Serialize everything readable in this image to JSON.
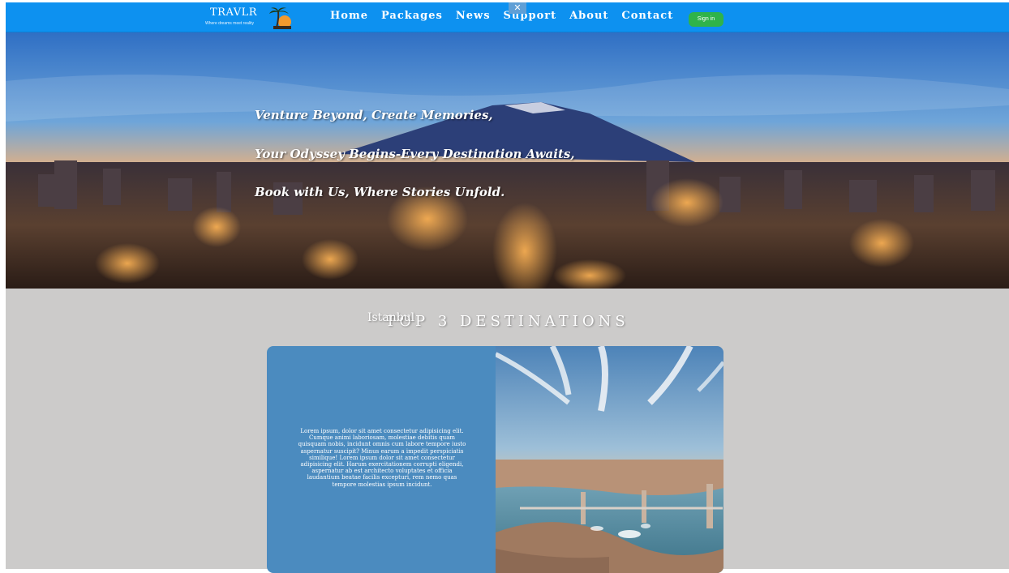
{
  "brand": {
    "name": "TRAVLR",
    "tagline": "Where dreams meet reality"
  },
  "nav": {
    "links": [
      "Home",
      "Packages",
      "News",
      "Support",
      "About",
      "Contact"
    ],
    "close_glyph": "✕",
    "signin_label": "Sign in"
  },
  "hero": {
    "lines": [
      "Venture Beyond, Create Memories,",
      "Your Odyssey Begins-Every Destination Awaits,",
      "Book with Us, Where Stories Unfold."
    ]
  },
  "destinations": {
    "title": "TOP 3 DESTINATIONS",
    "cards": [
      {
        "city": "Istanbul",
        "description": "Lorem ipsum, dolor sit amet consectetur adipisicing elit. Cumque animi laboriosam, molestiae debitis quam quisquam nobis, incidunt omnis cum labore tempore iusto aspernatur suscipit? Minus earum a impedit perspiciatis similique! Lorem ipsum dolor sit amet consectetur adipisicing elit. Harum exercitationem corrupti eligendi, aspernatur ab est architecto voluptates et officia laudantium beatae facilis excepturi, rem nemo quas tempore molestias ipsum incidunt."
      }
    ]
  },
  "colors": {
    "navbar": "#0d91f0",
    "signin": "#2fb34a",
    "section_bg": "#cccbca",
    "card_left": "#4b8bbf"
  },
  "icons": [
    "palm-tree-logo-icon",
    "close-icon",
    "mountain-city-hero-image",
    "istanbul-photo"
  ]
}
